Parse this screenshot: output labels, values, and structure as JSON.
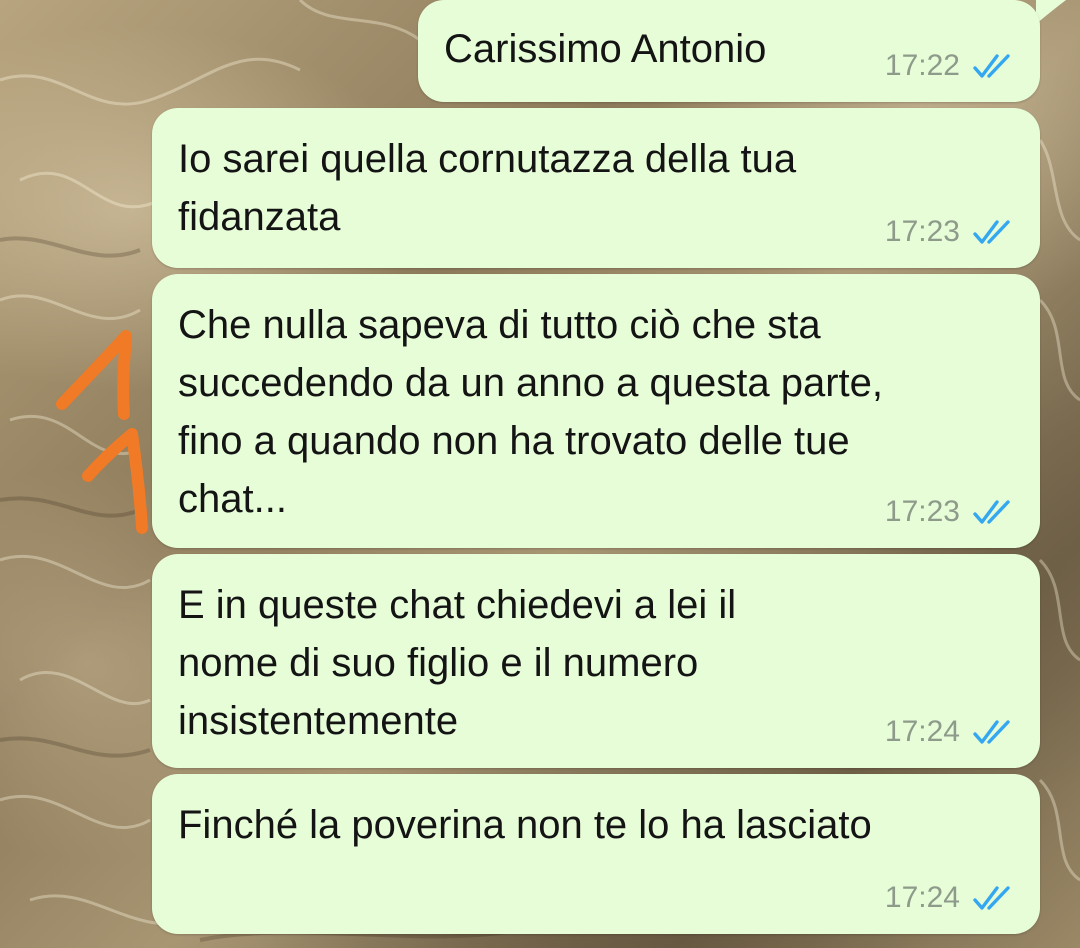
{
  "chat": {
    "messages": [
      {
        "text": "Carissimo Antonio",
        "time": "17:22",
        "status": "read"
      },
      {
        "text": "Io sarei quella cornutazza della tua\nfidanzata",
        "time": "17:23",
        "status": "read"
      },
      {
        "text": "Che nulla sapeva di tutto ciò che sta\nsuccedendo da un anno a questa parte,\nfino a quando non ha trovato delle tue\nchat...",
        "time": "17:23",
        "status": "read"
      },
      {
        "text": "E in queste chat chiedevi a lei il\nnome di suo figlio e il numero\ninsistentemente",
        "time": "17:24",
        "status": "read"
      },
      {
        "text": "Finché la poverina non te lo ha lasciato",
        "time": "17:24",
        "status": "read"
      }
    ]
  },
  "icons": {
    "read_receipt": "double-check-icon"
  },
  "colors": {
    "bubble_outgoing": "#e6fdd8",
    "message_text": "#141414",
    "time_text": "#8e9a8a",
    "read_ticks": "#34a7f0",
    "annotation_marker": "#f07a26"
  }
}
